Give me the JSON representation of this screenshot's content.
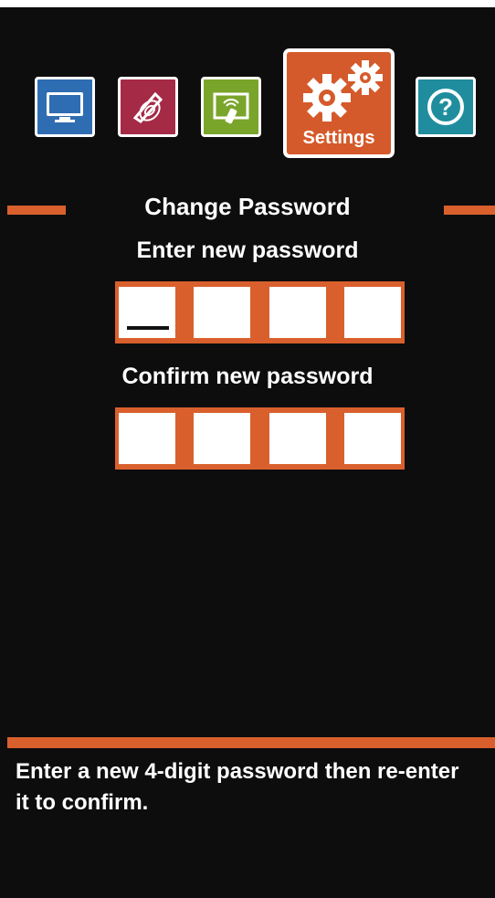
{
  "nav": {
    "tiles": [
      {
        "name": "display",
        "icon": "monitor-icon",
        "color": "#2f6db3"
      },
      {
        "name": "audio",
        "icon": "speaker-icon",
        "color": "#a52a46"
      },
      {
        "name": "remote",
        "icon": "remote-icon",
        "color": "#7aa52b"
      },
      {
        "name": "settings",
        "icon": "gears-icon",
        "color": "#d55a2b",
        "label": "Settings",
        "selected": true
      },
      {
        "name": "help",
        "icon": "help-icon",
        "color": "#1f8d9d"
      }
    ]
  },
  "screen": {
    "title": "Change Password",
    "enter_label": "Enter new password",
    "confirm_label": "Confirm new password",
    "pin_length": 4
  },
  "footer": {
    "help_text": "Enter a new 4-digit password then re-enter it to confirm."
  },
  "colors": {
    "accent": "#d9602d",
    "background": "#0d0d0d"
  }
}
